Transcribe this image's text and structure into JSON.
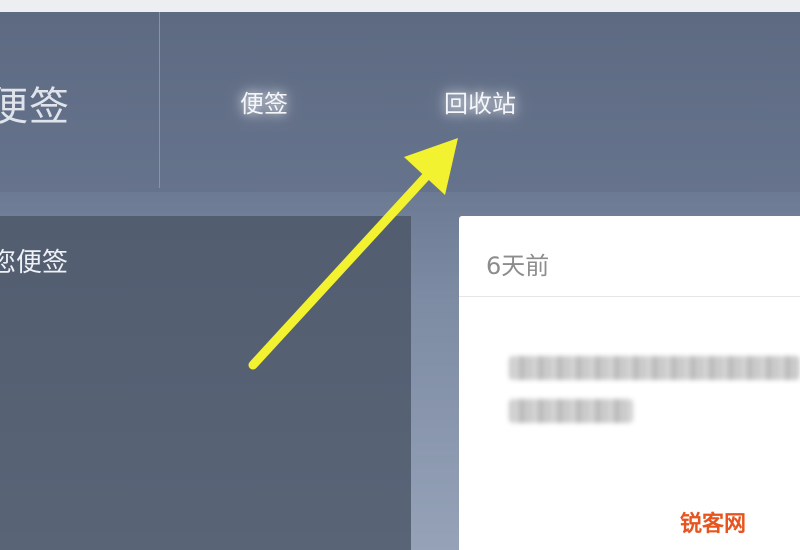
{
  "header": {
    "app_title": "便签",
    "tabs": [
      {
        "label": "便签"
      },
      {
        "label": "回收站"
      }
    ]
  },
  "left_panel": {
    "title": "您便签"
  },
  "note_card": {
    "time": "6天前"
  },
  "watermark": "锐客网",
  "colors": {
    "header_bg": "#5d6a82",
    "panel_bg": "#525d70",
    "arrow": "#f2f230",
    "watermark": "#e8541e"
  },
  "icons": [
    "arrow-annotation-icon"
  ]
}
